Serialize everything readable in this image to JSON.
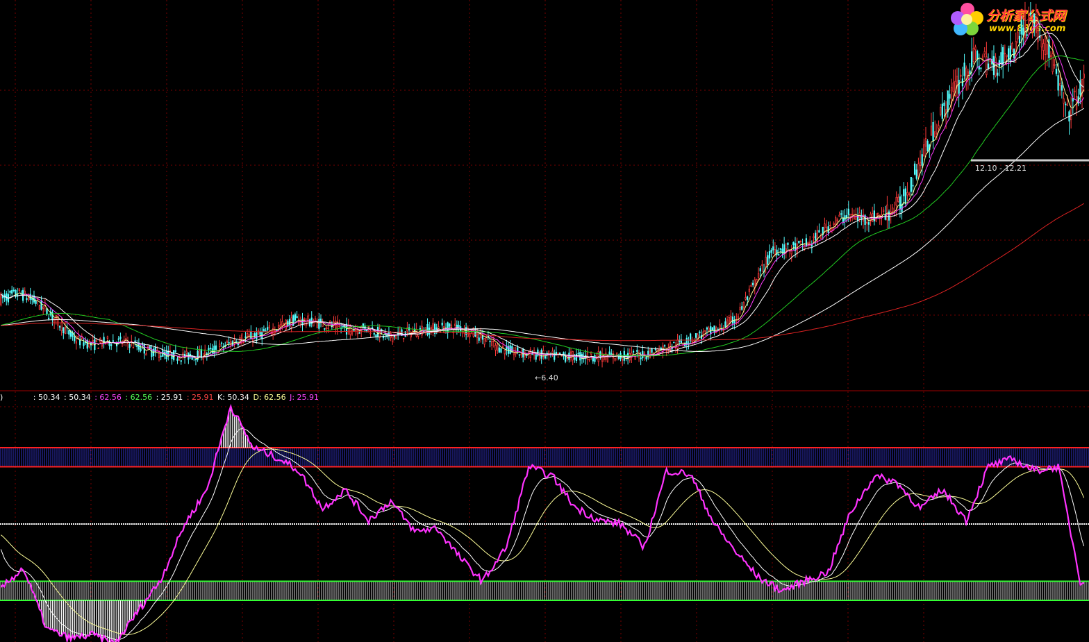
{
  "logo": {
    "name": "分析家公式网",
    "url": "www.88gs.com"
  },
  "price_chart": {
    "low_marker": "←6.40",
    "level_marker": "12.10 - 12.21"
  },
  "indicator_header": {
    "bracket": ")",
    "v1": ": 50.34",
    "v2": ": 50.34",
    "v3": ": 62.56",
    "v4": ": 62.56",
    "v5": ": 25.91",
    "v6": ": 25.91",
    "k": "K: 50.34",
    "d": "D: 62.56",
    "j": "J: 25.91"
  },
  "colors": {
    "background": "#000000",
    "grid": "#7a0000",
    "separator": "#a00000",
    "candle_up": "#ff3a3a",
    "candle_down": "#54ffff",
    "ma_white": "#ffffff",
    "ma_yellow": "#ffff99",
    "ma_magenta": "#ff3cff",
    "ma_green": "#22cc22",
    "ma_red": "#dd2222",
    "band_upper": "#3030c0",
    "band_lower": "#cccccc",
    "band_border_upper": "#ff2020",
    "band_border_lower": "#33ff33",
    "j_line": "#ff33ff"
  },
  "chart_data": [
    {
      "type": "candlestick",
      "title": "",
      "xlabel": "",
      "ylabel": "",
      "annotations": [
        "←6.40",
        "12.10 - 12.21"
      ],
      "grid": true,
      "price_path": [
        [
          0,
          8.0
        ],
        [
          10,
          8.15
        ],
        [
          20,
          7.9
        ],
        [
          30,
          7.45
        ],
        [
          40,
          6.95
        ],
        [
          50,
          6.8
        ],
        [
          60,
          6.9
        ],
        [
          70,
          6.85
        ],
        [
          80,
          6.65
        ],
        [
          90,
          6.55
        ],
        [
          100,
          6.5
        ],
        [
          110,
          6.55
        ],
        [
          120,
          6.75
        ],
        [
          130,
          6.95
        ],
        [
          140,
          7.05
        ],
        [
          150,
          7.25
        ],
        [
          160,
          7.45
        ],
        [
          170,
          7.4
        ],
        [
          180,
          7.3
        ],
        [
          190,
          7.2
        ],
        [
          200,
          7.25
        ],
        [
          210,
          7.0
        ],
        [
          220,
          7.1
        ],
        [
          230,
          7.2
        ],
        [
          240,
          7.25
        ],
        [
          250,
          7.25
        ],
        [
          260,
          7.05
        ],
        [
          270,
          6.75
        ],
        [
          280,
          6.6
        ],
        [
          290,
          6.55
        ],
        [
          300,
          6.5
        ],
        [
          310,
          6.5
        ],
        [
          320,
          6.5
        ],
        [
          330,
          6.5
        ],
        [
          340,
          6.5
        ],
        [
          350,
          6.55
        ],
        [
          360,
          6.7
        ],
        [
          370,
          6.85
        ],
        [
          380,
          7.05
        ],
        [
          390,
          7.2
        ],
        [
          400,
          7.5
        ],
        [
          410,
          8.4
        ],
        [
          420,
          9.3
        ],
        [
          430,
          9.3
        ],
        [
          440,
          9.45
        ],
        [
          450,
          9.9
        ],
        [
          460,
          10.2
        ],
        [
          470,
          10.1
        ],
        [
          480,
          10.2
        ],
        [
          490,
          10.5
        ],
        [
          500,
          11.6
        ],
        [
          510,
          12.7
        ],
        [
          520,
          13.6
        ],
        [
          530,
          14.3
        ],
        [
          540,
          14.1
        ],
        [
          550,
          14.5
        ],
        [
          560,
          15.4
        ],
        [
          570,
          14.5
        ],
        [
          580,
          12.8
        ],
        [
          589,
          13.6
        ]
      ],
      "moving_averages": [
        {
          "color": "ma_yellow",
          "period": 5
        },
        {
          "color": "ma_magenta",
          "period": 10
        },
        {
          "color": "ma_white",
          "period": 20
        },
        {
          "color": "ma_green",
          "period": 60
        },
        {
          "color": "ma_white",
          "period": 120
        },
        {
          "color": "ma_red",
          "period": 250
        }
      ]
    },
    {
      "type": "line",
      "title": "",
      "series": [
        {
          "name": "K",
          "last": 50.34,
          "color": "ma_white"
        },
        {
          "name": "D",
          "last": 62.56,
          "color": "ma_yellow"
        },
        {
          "name": "J",
          "last": 25.91,
          "color": "j_line"
        }
      ],
      "ylim": [
        -10,
        110
      ],
      "reference_levels": [
        80,
        50,
        20
      ],
      "upper_zone": [
        80,
        90
      ],
      "lower_zone": [
        10,
        20
      ],
      "j_path": [
        [
          0,
          16
        ],
        [
          12,
          27
        ],
        [
          25,
          -5
        ],
        [
          38,
          -10
        ],
        [
          50,
          -8
        ],
        [
          62,
          -13
        ],
        [
          75,
          5
        ],
        [
          87,
          21
        ],
        [
          100,
          50
        ],
        [
          112,
          68
        ],
        [
          125,
          112
        ],
        [
          137,
          90
        ],
        [
          150,
          85
        ],
        [
          162,
          78
        ],
        [
          175,
          58
        ],
        [
          187,
          68
        ],
        [
          200,
          52
        ],
        [
          212,
          62
        ],
        [
          225,
          46
        ],
        [
          237,
          48
        ],
        [
          250,
          32
        ],
        [
          262,
          20
        ],
        [
          275,
          38
        ],
        [
          287,
          80
        ],
        [
          300,
          75
        ],
        [
          312,
          59
        ],
        [
          325,
          52
        ],
        [
          337,
          50
        ],
        [
          350,
          38
        ],
        [
          362,
          78
        ],
        [
          375,
          76
        ],
        [
          388,
          50
        ],
        [
          400,
          35
        ],
        [
          412,
          22
        ],
        [
          425,
          15
        ],
        [
          437,
          20
        ],
        [
          450,
          25
        ],
        [
          462,
          56
        ],
        [
          475,
          75
        ],
        [
          487,
          72
        ],
        [
          500,
          58
        ],
        [
          512,
          68
        ],
        [
          525,
          52
        ],
        [
          537,
          80
        ],
        [
          550,
          84
        ],
        [
          562,
          78
        ],
        [
          575,
          80
        ],
        [
          587,
          20
        ],
        [
          595,
          23
        ]
      ]
    }
  ]
}
